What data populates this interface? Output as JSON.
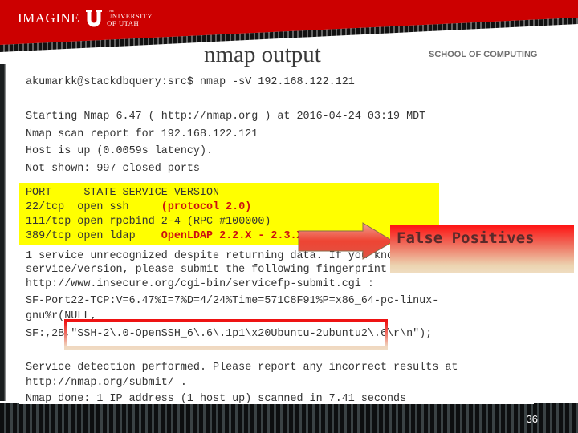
{
  "header": {
    "logo": {
      "imagine": "IMAGINE",
      "the": "THE",
      "university": "UNIVERSITY",
      "of_utah": "OF UTAH",
      "icon": "university-u-logo-icon"
    },
    "school": "SCHOOL OF COMPUTING",
    "title": "nmap output",
    "brand_color": "#cc0000"
  },
  "terminal": {
    "command": "akumarkk@stackdbquery:src$ nmap -sV 192.168.122.121",
    "lines": [
      "Starting Nmap 6.47 ( http://nmap.org ) at 2016-04-24 03:19 MDT",
      "Nmap scan report for 192.168.122.121",
      "Host is up (0.0059s latency).",
      "Not shown: 997 closed ports"
    ],
    "ports_table": {
      "header": "PORT     STATE SERVICE VERSION",
      "rows": [
        {
          "port": "22/tcp ",
          "state": "open ",
          "service": "ssh     ",
          "version": "(protocol 2.0)",
          "flagged": true
        },
        {
          "port": "111/tcp",
          "state": "open ",
          "service": "rpcbind ",
          "version": "2-4 (RPC #100000)",
          "flagged": false
        },
        {
          "port": "389/tcp",
          "state": "open ",
          "service": "ldap    ",
          "version": "OpenLDAP 2.2.X - 2.3.X",
          "flagged": true
        }
      ],
      "highlight_color": "#ffff00"
    },
    "fingerprint_lines": [
      "1 service unrecognized despite returning data. If you know the",
      "service/version, please submit the following fingerprint at",
      "http://www.insecure.org/cgi-bin/servicefp-submit.cgi :",
      "SF-Port22-TCP:V=6.47%I=7%D=4/24%Time=571C8F91%P=x86_64-pc-linux-",
      "gnu%r(NULL,",
      "SF:,2B,\"SSH-2\\.0-OpenSSH_6\\.6\\.1p1\\x20Ubuntu-2ubuntu2\\.6\\r\\n\");"
    ],
    "footer_lines": [
      "Service detection performed. Please report any incorrect results at",
      "http://nmap.org/submit/ .",
      "Nmap done: 1 IP address (1 host up) scanned in 7.41 seconds"
    ]
  },
  "callout": {
    "text": "False Positives",
    "icon": "right-arrow-icon"
  },
  "footer": {
    "page_number": "36"
  }
}
